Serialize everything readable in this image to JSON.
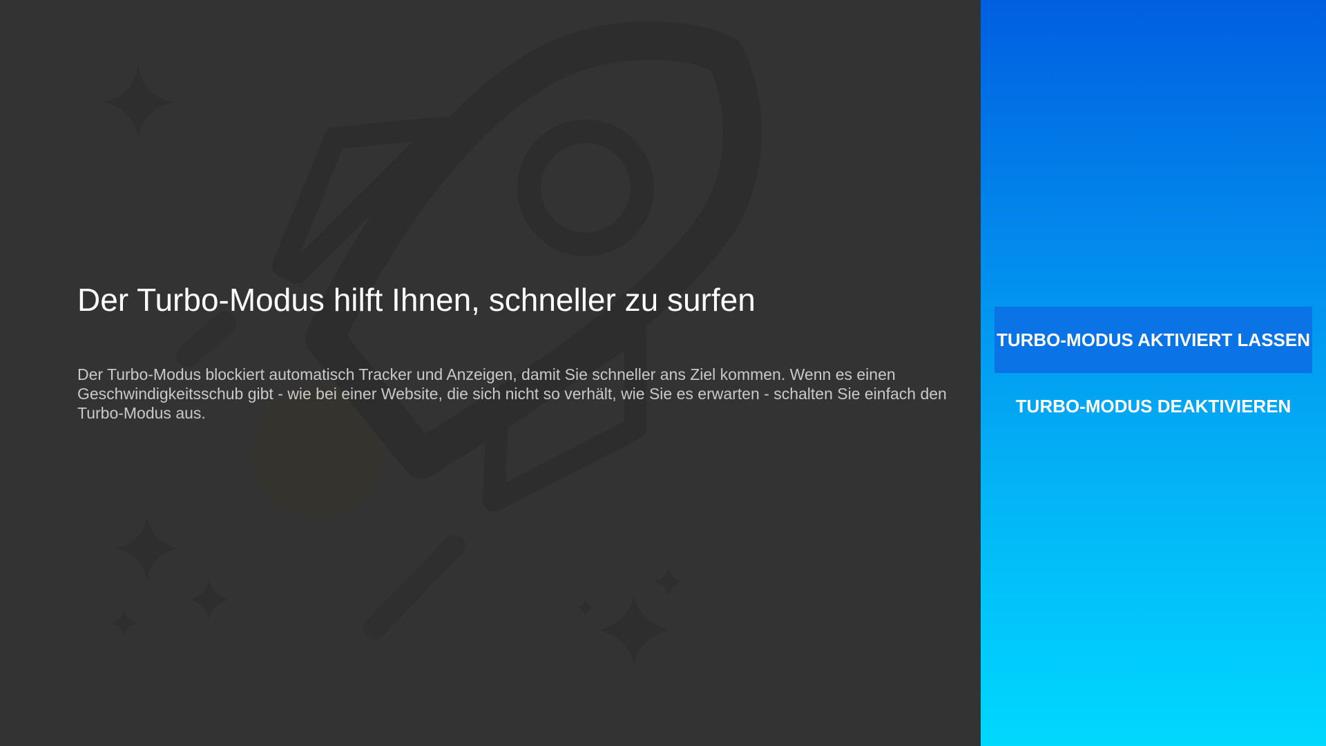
{
  "dialog": {
    "title": "Der Turbo-Modus hilft Ihnen, schneller zu surfen",
    "description": "Der Turbo-Modus blockiert automatisch Tracker und Anzeigen, damit Sie schneller ans Ziel kommen. Wenn es einen Geschwindigkeitsschub gibt - wie bei einer Website, die sich nicht so verhält, wie Sie es erwarten - schalten Sie einfach den Turbo-Modus aus."
  },
  "actions": {
    "keep_enabled_label": "TURBO-MODUS AKTIVIERT LASSEN",
    "disable_label": "TURBO-MODUS DEAKTIVIEREN"
  },
  "illustration": {
    "icons": [
      "rocket-icon",
      "sparkle-icon",
      "flame-icon"
    ]
  },
  "colors": {
    "background": "#333333",
    "panel_gradient_top": "#005fe0",
    "panel_gradient_bottom": "#00d8ff",
    "focused_button": "#0a74e6",
    "title_text": "#ffffff",
    "body_text": "#c9c9c9"
  }
}
